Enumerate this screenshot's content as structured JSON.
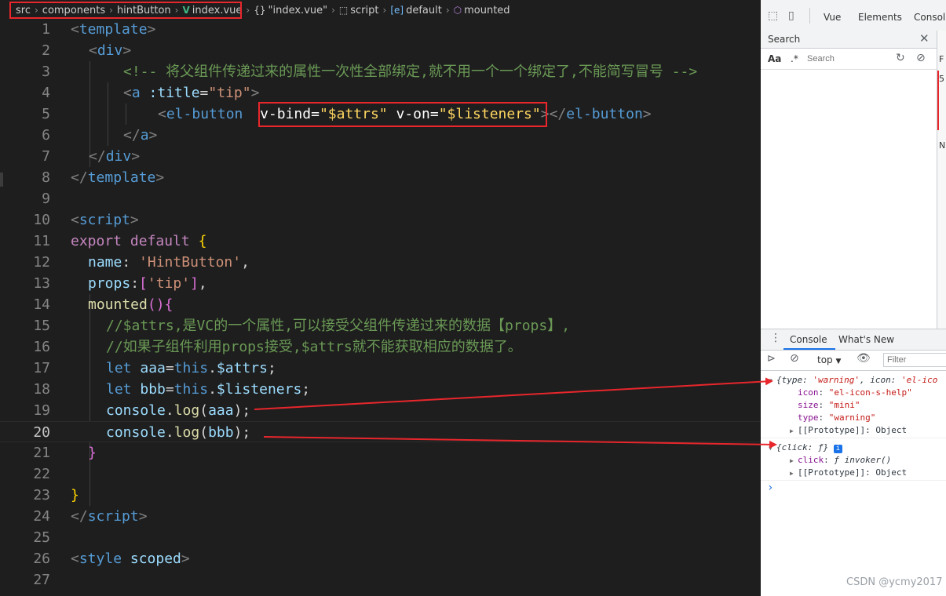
{
  "breadcrumb": {
    "items": [
      "src",
      "components",
      "hintButton",
      "index.vue",
      "\"index.vue\"",
      "script",
      "default",
      "mounted"
    ]
  },
  "line_numbers": [
    "1",
    "2",
    "3",
    "4",
    "5",
    "6",
    "7",
    "8",
    "9",
    "10",
    "11",
    "12",
    "13",
    "14",
    "15",
    "16",
    "17",
    "18",
    "19",
    "20",
    "21",
    "22",
    "23",
    "24",
    "25",
    "26",
    "27"
  ],
  "active_line": "20",
  "code": {
    "l1": [
      "<",
      "template",
      ">"
    ],
    "l2": [
      "<",
      "div",
      ">"
    ],
    "l3": "<!-- 将父组件传递过来的属性一次性全部绑定,就不用一个一个绑定了,不能简写冒号 -->",
    "l4": [
      "<",
      "a",
      " :title",
      "=",
      "\"tip\"",
      ">"
    ],
    "l5": [
      "<",
      "el-button",
      "v-bind",
      "=",
      "\"$attrs\"",
      " v-on",
      "=",
      "\"$listeners\"",
      "></",
      "el-button",
      ">"
    ],
    "l6": [
      "</",
      "a",
      ">"
    ],
    "l7": [
      "</",
      "div",
      ">"
    ],
    "l8": [
      "</",
      "template",
      ">"
    ],
    "l10": [
      "<",
      "script",
      ">"
    ],
    "l11": [
      "export",
      " default",
      " {"
    ],
    "l12": [
      "name",
      ": ",
      "'HintButton'",
      ","
    ],
    "l13": [
      "props",
      ":",
      "[",
      "'tip'",
      "]",
      ","
    ],
    "l14": [
      "mounted",
      "(",
      ")",
      "{"
    ],
    "l15": "//$attrs,是VC的一个属性,可以接受父组件传递过来的数据【props】,",
    "l16": "//如果子组件利用props接受,$attrs就不能获取相应的数据了。",
    "l17": [
      "let",
      " aaa",
      "=",
      "this",
      ".",
      "$attrs",
      ";"
    ],
    "l18": [
      "let",
      " bbb",
      "=",
      "this",
      ".",
      "$listeners",
      ";"
    ],
    "l19": [
      "console",
      ".",
      "log",
      "(",
      "aaa",
      ");"
    ],
    "l20": [
      "console",
      ".",
      "log",
      "(",
      "bbb",
      ");"
    ],
    "l21": "}",
    "l23": "}",
    "l24": [
      "</",
      "script",
      ">"
    ],
    "l26": [
      "<",
      "style",
      " scoped",
      ">"
    ]
  },
  "devtools": {
    "tabs": [
      "Vue",
      "Elements",
      "Console"
    ],
    "search_tab": "Search",
    "search_aa": "Aa",
    "search_regex": ".*",
    "search_placeholder": "Search",
    "drawer_tabs": [
      "Console",
      "What's New"
    ],
    "context": "top",
    "filter_placeholder": "Filter",
    "right_cut": [
      "F",
      "5",
      "N"
    ],
    "log1": {
      "summary": [
        "{type: ",
        "'warning'",
        ", icon: ",
        "'el-ico"
      ],
      "props": [
        {
          "key": "icon",
          "value": "\"el-icon-s-help\""
        },
        {
          "key": "size",
          "value": "\"mini\""
        },
        {
          "key": "type",
          "value": "\"warning\""
        }
      ],
      "proto": [
        "[[Prototype]]",
        ": Object"
      ]
    },
    "log2": {
      "summary": "{click: ƒ}",
      "info": "i",
      "click": [
        "click",
        ": ",
        "ƒ ",
        "invoker()"
      ],
      "proto": [
        "[[Prototype]]",
        ": Object"
      ]
    },
    "prompt": "›"
  },
  "watermark": "CSDN @ycmy2017",
  "colors": {
    "annotation_red": "#e8262c",
    "editor_bg": "#1e1e1e"
  }
}
